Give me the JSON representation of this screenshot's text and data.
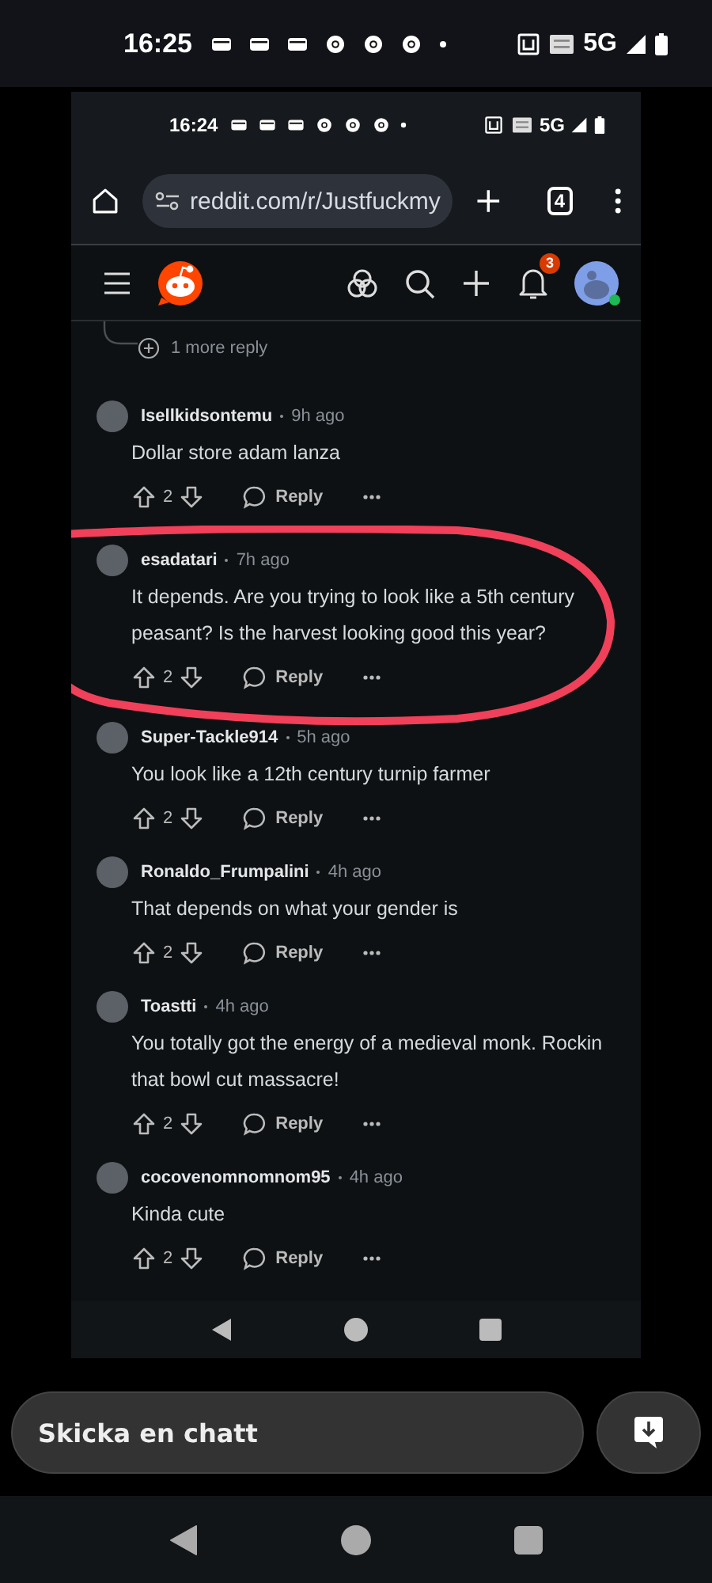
{
  "status_bar": {
    "time": "16:25",
    "network": "5G"
  },
  "shared_screenshot": {
    "status_bar": {
      "time": "16:24",
      "network": "5G"
    },
    "browser": {
      "url": "reddit.com/r/Justfuckmy",
      "tab_count": "4"
    },
    "app_header": {
      "notification_count": "3",
      "online": true
    },
    "more_replies": "1 more reply",
    "comments": [
      {
        "username": "Isellkidsontemu",
        "age": "9h ago",
        "text": "Dollar store adam lanza",
        "score": "2",
        "reply": "Reply",
        "highlighted": false
      },
      {
        "username": "esadatari",
        "age": "7h ago",
        "text": "It depends. Are you trying to look like a 5th century peasant? Is the harvest looking good this year?",
        "score": "2",
        "reply": "Reply",
        "highlighted": true
      },
      {
        "username": "Super-Tackle914",
        "age": "5h ago",
        "text": "You look like a 12th century turnip farmer",
        "score": "2",
        "reply": "Reply",
        "highlighted": false
      },
      {
        "username": "Ronaldo_Frumpalini",
        "age": "4h ago",
        "text": "That depends on what your gender is",
        "score": "2",
        "reply": "Reply",
        "highlighted": false
      },
      {
        "username": "Toastti",
        "age": "4h ago",
        "text": "You totally got the energy of a medieval monk. Rockin that bowl cut massacre!",
        "score": "2",
        "reply": "Reply",
        "highlighted": false
      },
      {
        "username": "cocovenomnomnom95",
        "age": "4h ago",
        "text": "Kinda cute",
        "score": "2",
        "reply": "Reply",
        "highlighted": false
      }
    ]
  },
  "chat": {
    "placeholder": "Skicka en chatt"
  }
}
